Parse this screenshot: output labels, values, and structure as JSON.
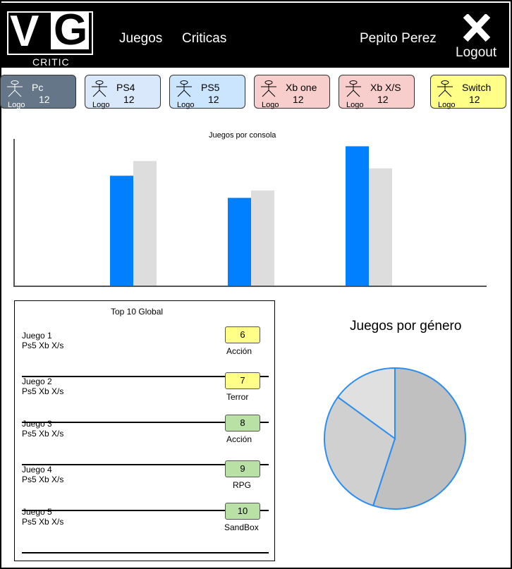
{
  "header": {
    "logo_initials_v": "V",
    "logo_initials_g": "G",
    "logo_subtitle": "CRITIC",
    "nav": [
      {
        "label": "Juegos"
      },
      {
        "label": "Criticas"
      }
    ],
    "user_name": "Pepito Perez",
    "logout_label": "Logout",
    "colors": {
      "background": "#000000",
      "text": "#ffffff"
    }
  },
  "consoles": [
    {
      "name": "Pc",
      "count": "12",
      "logo": "Logo",
      "bg": "#647687",
      "text": "#ffffff"
    },
    {
      "name": "PS4",
      "count": "12",
      "logo": "Logo",
      "bg": "#dae8fc",
      "text": "#000000"
    },
    {
      "name": "PS5",
      "count": "12",
      "logo": "Logo",
      "bg": "#cce5ff",
      "text": "#000000"
    },
    {
      "name": "Xb one",
      "count": "12",
      "logo": "Logo",
      "bg": "#f8cecc",
      "text": "#000000"
    },
    {
      "name": "Xb X/S",
      "count": "12",
      "logo": "Logo",
      "bg": "#f8cecc",
      "text": "#000000"
    },
    {
      "name": "Switch",
      "count": "12",
      "logo": "Logo",
      "bg": "#ffff88",
      "text": "#000000"
    }
  ],
  "chart_data": [
    {
      "type": "bar",
      "title": "Juegos por consola",
      "categories": [
        "",
        "",
        ""
      ],
      "series": [
        {
          "values": [
            75,
            60,
            95
          ],
          "color": "#007fff"
        },
        {
          "values": [
            85,
            65,
            80
          ],
          "color": "#dddddd"
        }
      ],
      "ylim": [
        0,
        100
      ],
      "grid": false
    },
    {
      "type": "pie",
      "title": "Juegos por género",
      "values": [
        55,
        30,
        15
      ],
      "colors": [
        "#c0c0c0",
        "#d0d0d0",
        "#e0e0e0"
      ],
      "stroke": "#2b8ef0"
    }
  ],
  "top10": {
    "title": "Top 10 Global",
    "games": [
      {
        "name": "Juego 1",
        "platforms": "Ps5 Xb X/s",
        "score": "6",
        "genre": "Acción",
        "score_bg": "#ffff88"
      },
      {
        "name": "Juego 2",
        "platforms": "Ps5 Xb X/s",
        "score": "7",
        "genre": "Terror",
        "score_bg": "#ffff88"
      },
      {
        "name": "Juego 3",
        "platforms": "Ps5 Xb X/s",
        "score": "8",
        "genre": "Acción",
        "score_bg": "#b9e0a5"
      },
      {
        "name": "Juego 4",
        "platforms": "Ps5 Xb X/s",
        "score": "9",
        "genre": "RPG",
        "score_bg": "#b9e0a5"
      },
      {
        "name": "Juego 5",
        "platforms": "Ps5 Xb X/s",
        "score": "10",
        "genre": "SandBox",
        "score_bg": "#b9e0a5"
      }
    ]
  }
}
